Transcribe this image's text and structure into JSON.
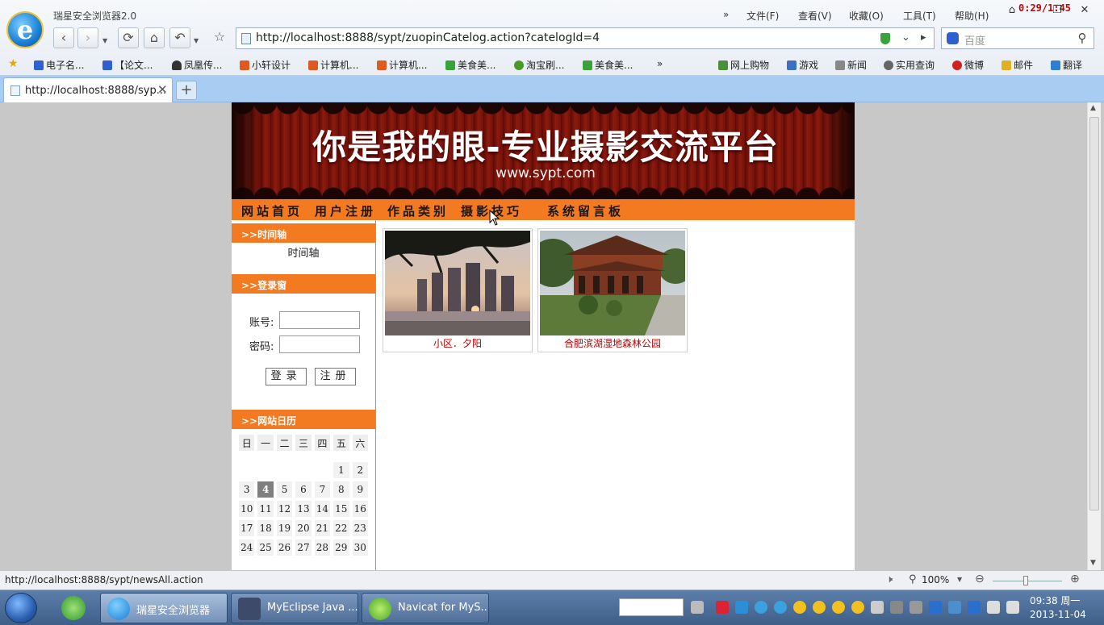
{
  "browser": {
    "app_title": "瑞星安全浏览器2.0",
    "timer": "0:29/1:45",
    "menu": [
      "文件(F)",
      "查看(V)",
      "收藏(O)",
      "工具(T)",
      "帮助(H)"
    ],
    "menu_more": "»",
    "url": "http://localhost:8888/sypt/zuopinCatelog.action?catelogId=4",
    "search_placeholder": "百度",
    "bookmarks_left": [
      "电子名...",
      "【论文...",
      "凤凰传...",
      "小轩设计",
      "计算机...",
      "计算机...",
      "美食美...",
      "淘宝刷...",
      "美食美..."
    ],
    "bookmarks_more": "»",
    "bookmarks_right": [
      "网上购物",
      "游戏",
      "新闻",
      "实用查询",
      "微博",
      "邮件",
      "翻译"
    ],
    "tab_label": "http://localhost:8888/syp...",
    "new_tab": "+",
    "status_url": "http://localhost:8888/sypt/newsAll.action",
    "zoom": "100%"
  },
  "site": {
    "banner_title": "你是我的眼-专业摄影交流平台",
    "banner_sub": "www.sypt.com",
    "nav": [
      "网站首页",
      "用户注册",
      "作品类别",
      "摄影技巧",
      "系统留言板"
    ],
    "sidebar": {
      "timeline_head": ">>时间轴",
      "timeline_text": "时间轴",
      "login_head": ">>登录窗",
      "account_label": "账号:",
      "password_label": "密码:",
      "login_btn": "登录",
      "register_btn": "注册",
      "calendar_head": ">>网站日历",
      "weekdays": [
        "日",
        "一",
        "二",
        "三",
        "四",
        "五",
        "六"
      ],
      "weeks": [
        [
          "",
          "",
          "",
          "",
          "",
          "1",
          "2"
        ],
        [
          "3",
          "4",
          "5",
          "6",
          "7",
          "8",
          "9"
        ],
        [
          "10",
          "11",
          "12",
          "13",
          "14",
          "15",
          "16"
        ],
        [
          "17",
          "18",
          "19",
          "20",
          "21",
          "22",
          "23"
        ],
        [
          "24",
          "25",
          "26",
          "27",
          "28",
          "29",
          "30"
        ]
      ],
      "today": "4"
    },
    "gallery": [
      {
        "caption": "小区．夕阳"
      },
      {
        "caption": "合肥滨湖湿地森林公园"
      }
    ]
  },
  "taskbar": {
    "buttons": [
      "瑞星安全浏览器",
      "MyEclipse Java ...",
      "Navicat for MyS..."
    ],
    "time": "09:38 周一",
    "date": "2013-11-04"
  }
}
